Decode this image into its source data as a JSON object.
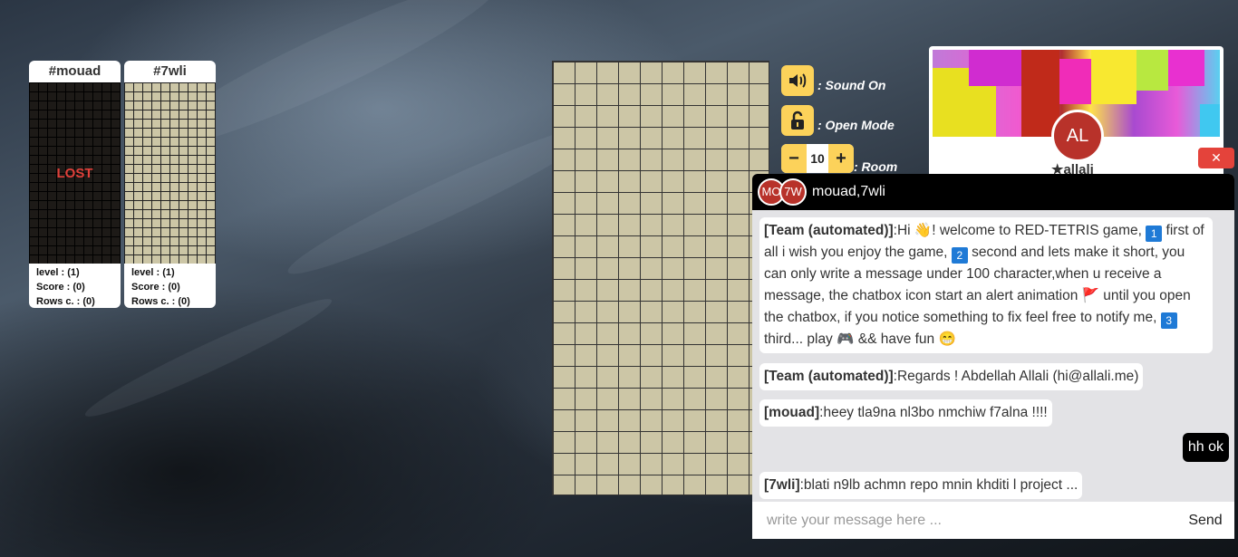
{
  "opponents": [
    {
      "name": "#mouad",
      "status": "LOST",
      "level": "level : (1)",
      "score": "Score : (0)",
      "rows": "Rows c. : (0)"
    },
    {
      "name": "#7wli",
      "status": "",
      "level": "level : (1)",
      "score": "Score : (0)",
      "rows": "Rows c. : (0)"
    }
  ],
  "controls": {
    "sound_label": ": Sound On",
    "mode_label": ": Open Mode",
    "room_label": ": Room",
    "room_value": "10",
    "minus": "−",
    "plus": "+"
  },
  "profile": {
    "initials": "AL",
    "name": "★allali",
    "close": "✕"
  },
  "chat": {
    "avatars": [
      "MO",
      "7W"
    ],
    "title": "mouad,7wli",
    "messages": [
      {
        "author": "[Team (automated)]",
        "text_parts": [
          ":Hi 👋! welcome to RED-TETRIS game, ",
          "1",
          " first of all i wish you enjoy the game, ",
          "2",
          " second and lets make it short, you can only write a message under 100 character,when u receive a message, the chatbox icon start an alert animation 🚩 until you open the chatbox, if you notice something to fix feel free to notify me, ",
          "3",
          " third... play 🎮 && have fun 😁"
        ]
      },
      {
        "author": "[Team (automated)]",
        "text": ":Regards ! Abdellah Allali (hi@allali.me)"
      },
      {
        "author": "[mouad]",
        "text": ":heey tla9na nl3bo nmchiw f7alna !!!!"
      },
      {
        "author": "[7wli]",
        "text": ":blati n9lb achmn repo mnin khditi l project ..."
      }
    ],
    "my_message": "hh ok",
    "input_placeholder": "write your message here ...",
    "send_label": "Send"
  }
}
